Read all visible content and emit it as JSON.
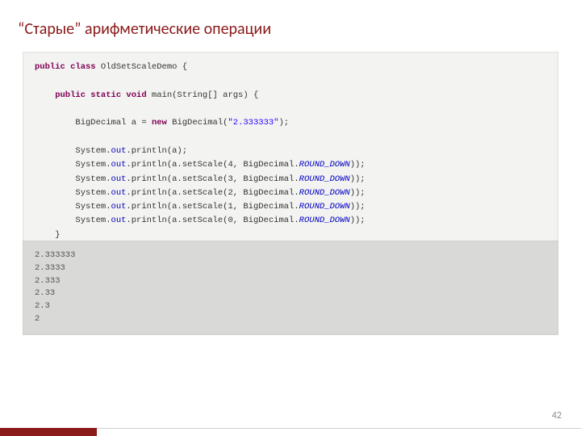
{
  "title": "“Старые” арифметические операции",
  "code": {
    "l1a": "public class",
    "l1b": " OldSetScaleDemo {",
    "l2a": "    public static void",
    "l2b": " main(String[] args) {",
    "l3a": "        BigDecimal a = ",
    "l3b": "new",
    "l3c": " BigDecimal(",
    "l3d": "\"2.333333\"",
    "l3e": ");",
    "l4a": "        System.",
    "l4b": "out",
    "l4c": ".println(a);",
    "l5a": "        System.",
    "l5b": "out",
    "l5c": ".println(a.setScale(4, BigDecimal.",
    "l5d": "ROUND_DOWN",
    "l5e": "));",
    "l6a": "        System.",
    "l6b": "out",
    "l6c": ".println(a.setScale(3, BigDecimal.",
    "l6d": "ROUND_DOWN",
    "l6e": "));",
    "l7a": "        System.",
    "l7b": "out",
    "l7c": ".println(a.setScale(2, BigDecimal.",
    "l7d": "ROUND_DOWN",
    "l7e": "));",
    "l8a": "        System.",
    "l8b": "out",
    "l8c": ".println(a.setScale(1, BigDecimal.",
    "l8d": "ROUND_DOWN",
    "l8e": "));",
    "l9a": "        System.",
    "l9b": "out",
    "l9c": ".println(a.setScale(0, BigDecimal.",
    "l9d": "ROUND_DOWN",
    "l9e": "));",
    "l10": "    }",
    "l11": "}"
  },
  "output": "2.333333\n2.3333\n2.333\n2.33\n2.3\n2",
  "pageNumber": "42"
}
